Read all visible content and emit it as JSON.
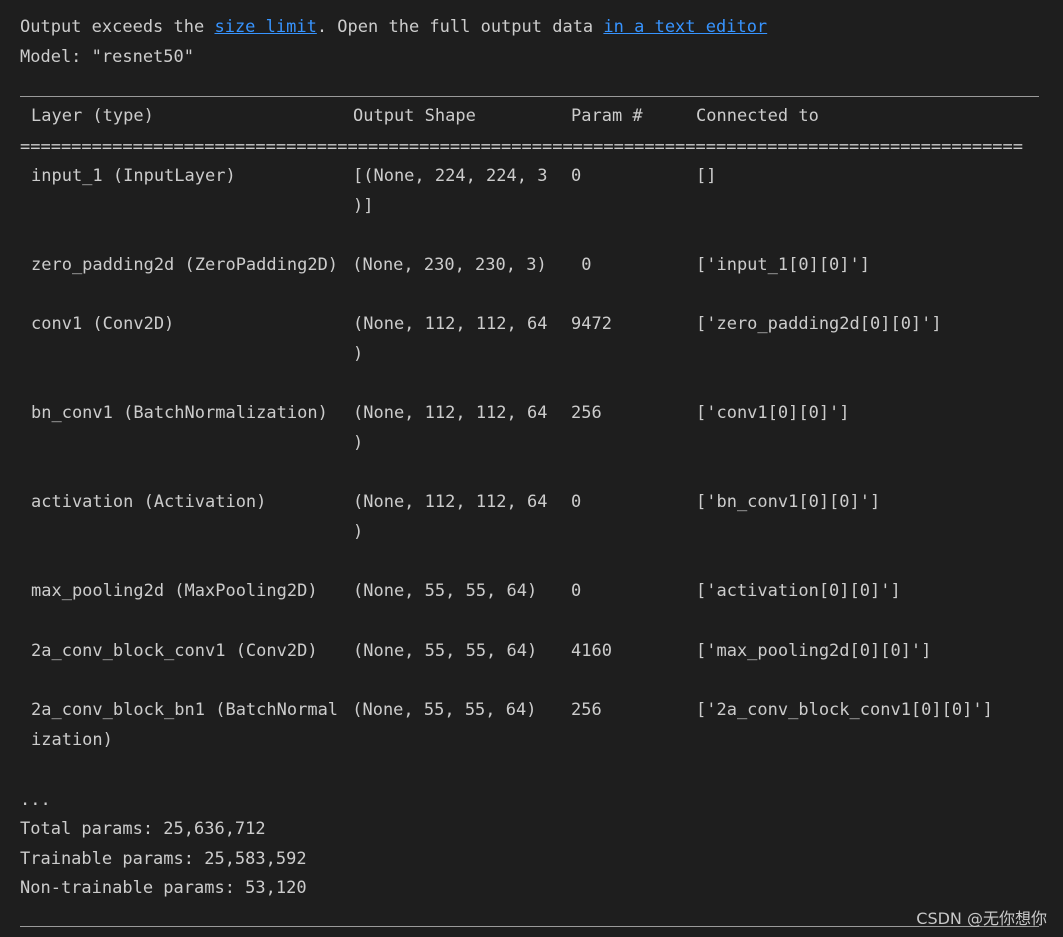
{
  "notice": {
    "prefix": "Output exceeds the ",
    "size_limit_link": "size limit",
    "middle": ". Open the full output data ",
    "editor_link": "in a text editor"
  },
  "model_line": "Model: \"resnet50\"",
  "separator_eq": "==================================================================================================",
  "header": {
    "layer": "Layer (type)",
    "shape": "Output Shape",
    "param": "Param #",
    "connected": "Connected to"
  },
  "rows": [
    {
      "layer": "input_1 (InputLayer)",
      "shape": "[(None, 224, 224, 3",
      "shape2": ")]",
      "param": "0",
      "connected": "[]",
      "layer2": ""
    },
    {
      "layer": "zero_padding2d (ZeroPadding2D)",
      "shape": " (None, 230, 230, 3)",
      "shape2": "",
      "param": " 0",
      "connected": "['input_1[0][0]']",
      "layer2": ""
    },
    {
      "layer": "conv1 (Conv2D)",
      "shape": "(None, 112, 112, 64",
      "shape2": ")",
      "param": "9472",
      "connected": "['zero_padding2d[0][0]']",
      "layer2": ""
    },
    {
      "layer": "bn_conv1 (BatchNormalization)",
      "shape": "(None, 112, 112, 64",
      "shape2": ")",
      "param": "256",
      "connected": "['conv1[0][0]']",
      "layer2": ""
    },
    {
      "layer": "activation (Activation)",
      "shape": "(None, 112, 112, 64",
      "shape2": ")",
      "param": "0",
      "connected": "['bn_conv1[0][0]']",
      "layer2": ""
    },
    {
      "layer": "max_pooling2d (MaxPooling2D)",
      "shape": "(None, 55, 55, 64)",
      "shape2": "",
      "param": "0",
      "connected": "['activation[0][0]']",
      "layer2": ""
    },
    {
      "layer": "2a_conv_block_conv1 (Conv2D)",
      "shape": "(None, 55, 55, 64)",
      "shape2": "",
      "param": "4160",
      "connected": "['max_pooling2d[0][0]']",
      "layer2": ""
    },
    {
      "layer": "2a_conv_block_bn1 (BatchNormal",
      "shape": " (None, 55, 55, 64)",
      "shape2": "",
      "param": "256",
      "connected": "['2a_conv_block_conv1[0][0]']",
      "layer2": "ization)"
    }
  ],
  "ellipsis": "...",
  "totals": {
    "total": "Total params: 25,636,712",
    "trainable": "Trainable params: 25,583,592",
    "non_trainable": "Non-trainable params: 53,120"
  },
  "watermark": "CSDN @无你想你"
}
